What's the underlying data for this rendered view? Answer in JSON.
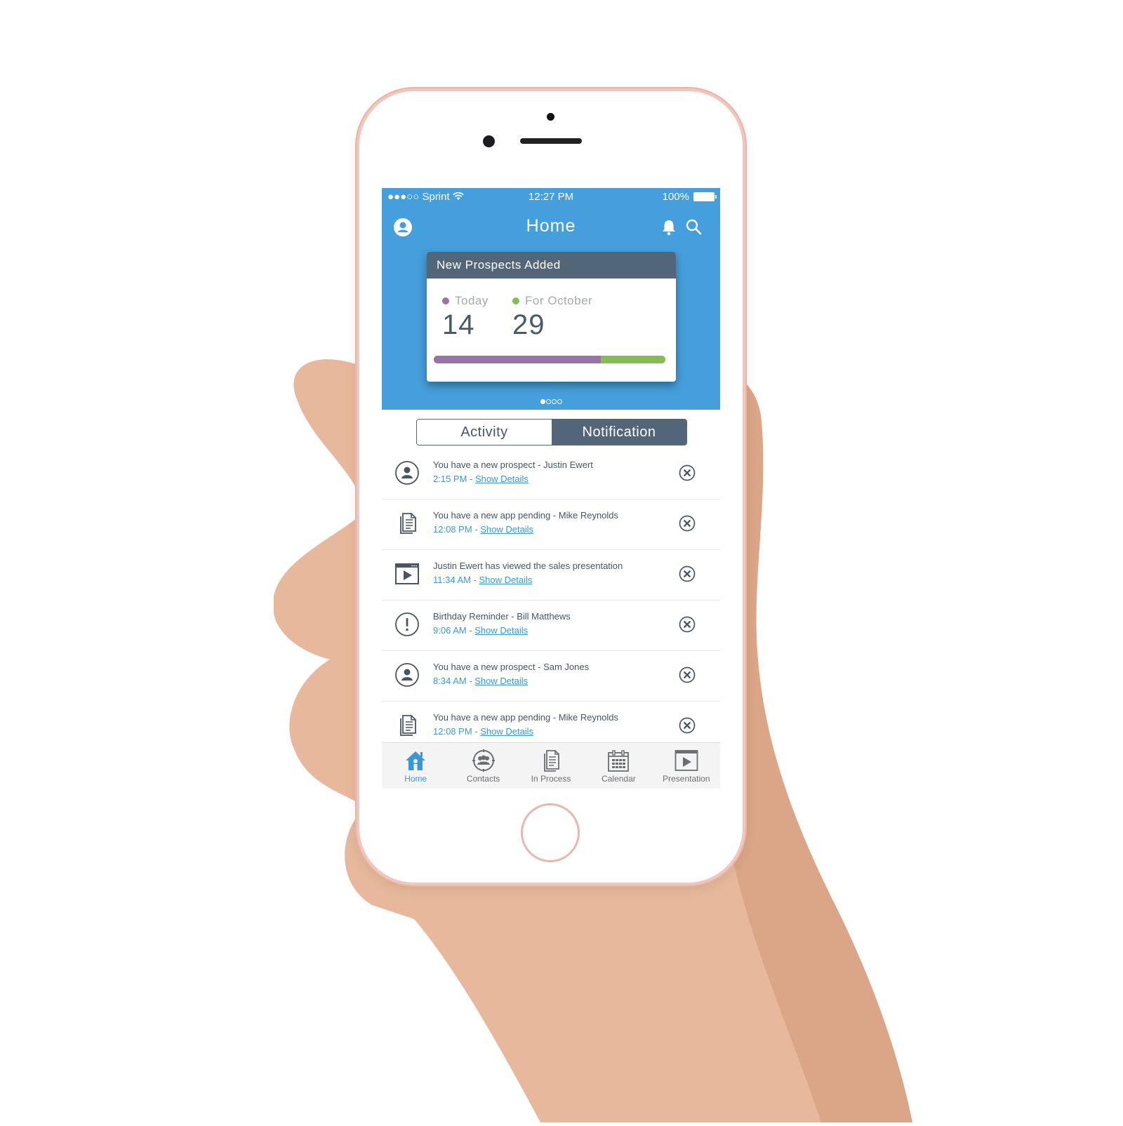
{
  "status_bar": {
    "carrier": "●●●○○ Sprint",
    "time": "12:27 PM",
    "battery": "100%"
  },
  "navbar": {
    "title": "Home",
    "left_icon": "profile-icon",
    "right_icons": [
      "bell-icon",
      "search-icon"
    ]
  },
  "prospects_card": {
    "title": "New Prospects Added",
    "stats": [
      {
        "label": "Today",
        "value": "14",
        "color": "#9873a8"
      },
      {
        "label": "For October",
        "value": "29",
        "color": "#86bd52"
      }
    ],
    "progress_today_fraction": 0.72,
    "pager": {
      "pages": 4,
      "active": 0
    }
  },
  "segmented_control": {
    "tabs": [
      {
        "label": "Activity",
        "active": false
      },
      {
        "label": "Notification",
        "active": true
      }
    ]
  },
  "notifications": [
    {
      "icon": "person-icon",
      "message": "You have a new prospect - Justin Ewert",
      "time": "2:15 PM - ",
      "link": "Show Details"
    },
    {
      "icon": "document-icon",
      "message": "You have a new app pending - Mike Reynolds",
      "time": "12:08 PM - ",
      "link": "Show Details"
    },
    {
      "icon": "video-icon",
      "message": "Justin Ewert has viewed the sales presentation",
      "time": "11:34 AM - ",
      "link": "Show Details"
    },
    {
      "icon": "alert-icon",
      "message": "Birthday Reminder - Bill Matthews",
      "time": "9:06 AM - ",
      "link": "Show Details"
    },
    {
      "icon": "person-icon",
      "message": "You have a new prospect - Sam Jones",
      "time": "8:34 AM - ",
      "link": "Show Details"
    },
    {
      "icon": "document-icon",
      "message": "You have a new app pending - Mike Reynolds",
      "time": "12:08 PM - ",
      "link": "Show Details"
    }
  ],
  "tab_bar": [
    {
      "label": "Home",
      "icon": "home-icon",
      "active": true
    },
    {
      "label": "Contacts",
      "icon": "contacts-icon",
      "active": false
    },
    {
      "label": "In Process",
      "icon": "document-icon",
      "active": false
    },
    {
      "label": "Calendar",
      "icon": "calendar-icon",
      "active": false
    },
    {
      "label": "Presentation",
      "icon": "video-icon",
      "active": false
    }
  ],
  "colors": {
    "header_blue": "#459fdc",
    "slate": "#536679",
    "link_blue": "#3c97d6",
    "today_purple": "#9873a8",
    "october_green": "#86bd52"
  }
}
